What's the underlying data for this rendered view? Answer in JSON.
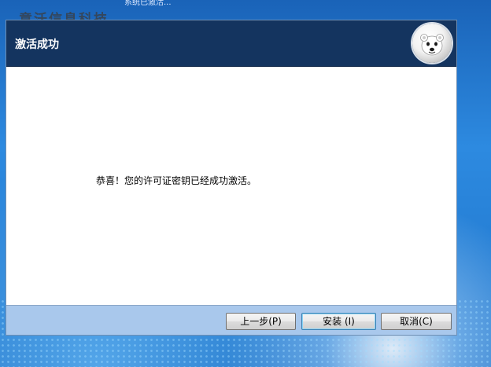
{
  "desktop": {
    "watermark": "意沃信息科技",
    "top_clip_text": "系统已激活..."
  },
  "dialog": {
    "title": "激活成功",
    "logo_icon": "polar-bear-icon",
    "message": "恭喜！您的许可证密钥已经成功激活。",
    "buttons": {
      "back": "上一步(P)",
      "install": "安装 (I)",
      "cancel": "取消(C)"
    },
    "colors": {
      "header": "#14345f",
      "footer": "#a9c8ec",
      "content": "#ffffff"
    }
  }
}
